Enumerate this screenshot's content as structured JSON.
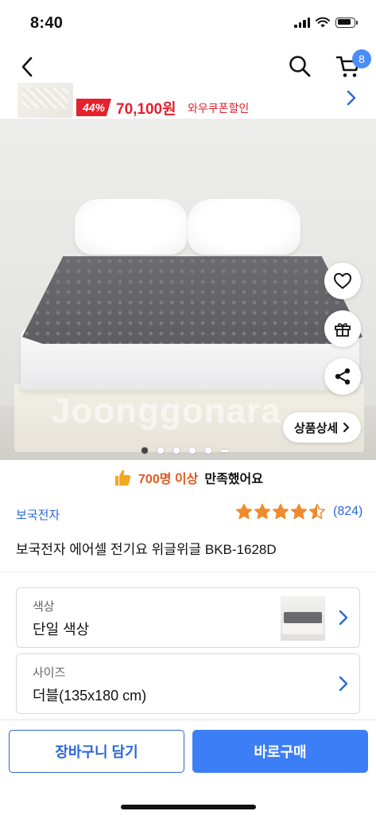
{
  "status_bar": {
    "time": "8:40",
    "battery_level": 0.85
  },
  "nav": {
    "cart_count": "8",
    "icons": [
      "back-icon",
      "search-icon",
      "cart-icon"
    ]
  },
  "promo": {
    "discount": "44%",
    "price": "70,100원",
    "coupon": "와우쿠폰할인"
  },
  "hero": {
    "watermark": "Joonggonara",
    "detail_button": "상품상세",
    "carousel_dots": 6,
    "active_dot": 1
  },
  "satisfaction": {
    "count": "700명 이상",
    "suffix": "만족했어요"
  },
  "product": {
    "brand": "보국전자",
    "rating": 4.5,
    "review_count": "(824)",
    "title": "보국전자 에어셀 전기요 위글위글 BKB-1628D"
  },
  "options": {
    "color": {
      "label": "색상",
      "value": "단일 색상"
    },
    "size": {
      "label": "사이즈",
      "value": "더블(135x180 cm)"
    }
  },
  "actions": {
    "add_to_cart": "장바구니 담기",
    "buy_now": "바로구매"
  },
  "colors": {
    "accent": "#3c7ef5",
    "link": "#2a66d9",
    "sale": "#e4212c",
    "star": "#f08a2d"
  }
}
